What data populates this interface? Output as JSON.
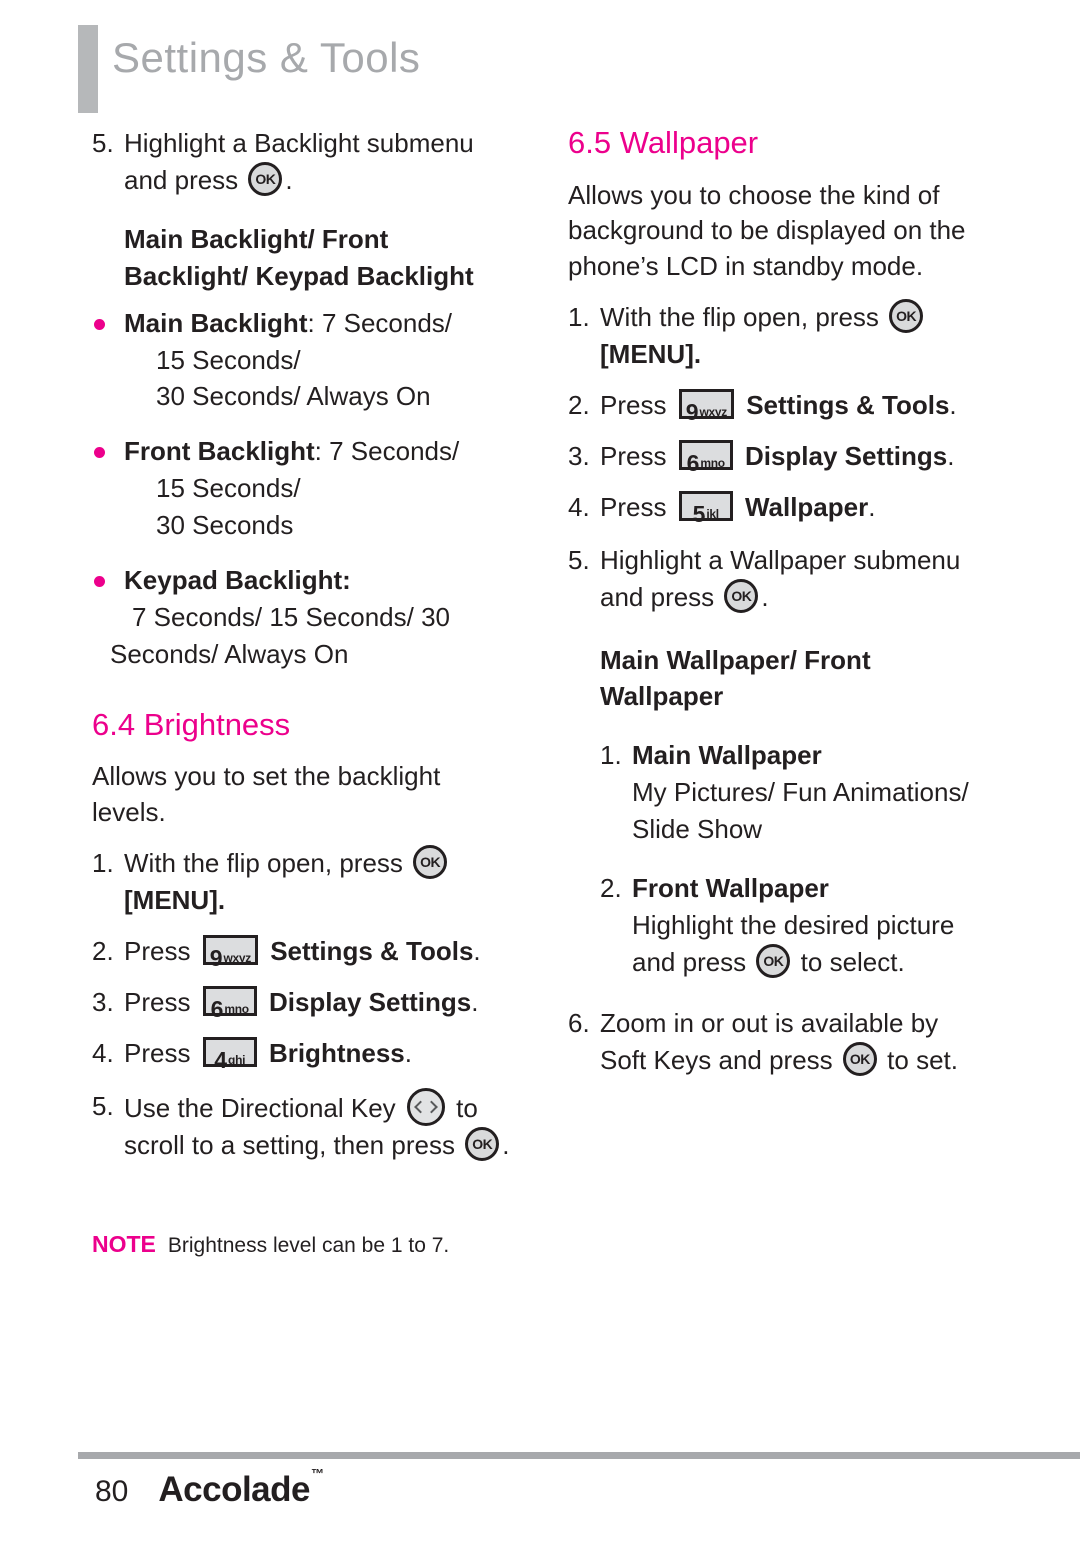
{
  "header": {
    "title": "Settings & Tools"
  },
  "icons": {
    "ok": "ok-key-icon",
    "directional": "directional-key-icon",
    "key9": {
      "digit": "9",
      "letters": "wxyz"
    },
    "key6": {
      "digit": "6",
      "letters": "mno"
    },
    "key5": {
      "digit": "5",
      "letters": "jkl"
    },
    "key4": {
      "digit": "4",
      "letters": "ghi"
    }
  },
  "colors": {
    "accent_pink": "#EC008C",
    "header_gray": "#A7A9AC",
    "bar_gray": "#B6B8BA",
    "text": "#231F20"
  },
  "left_column": {
    "step5": {
      "num": "5.",
      "text_before": "Highlight a Backlight submenu and press",
      "text_after": "."
    },
    "subhead": "Main Backlight/ Front Backlight/ Keypad Backlight",
    "bullets": [
      {
        "label": "Main Backlight",
        "sep": ": ",
        "values": [
          "7 Seconds/",
          "15 Seconds/",
          "30 Seconds/ Always On"
        ]
      },
      {
        "label": "Front Backlight",
        "sep": ": ",
        "values": [
          "7 Seconds/",
          "15 Seconds/",
          "30 Seconds"
        ]
      },
      {
        "label": "Keypad Backlight:",
        "sep": "",
        "values": [
          "7 Seconds/ 15 Seconds/ 30",
          "Seconds/ Always On"
        ]
      }
    ],
    "section": {
      "heading": "6.4 Brightness",
      "intro": "Allows you to set the backlight levels.",
      "steps": [
        {
          "num": "1.",
          "before": "With the flip open, press",
          "after": "",
          "after_bold": "[MENU]."
        },
        {
          "num": "2.",
          "before": "Press",
          "key": "key9",
          "after_bold": "Settings & Tools",
          "after": "."
        },
        {
          "num": "3.",
          "before": "Press",
          "key": "key6",
          "after_bold": "Display Settings",
          "after": "."
        },
        {
          "num": "4.",
          "before": "Press",
          "key": "key4",
          "after_bold": "Brightness",
          "after": "."
        },
        {
          "num": "5.",
          "before": "Use the Directional Key",
          "mid": "to scroll to a setting, then press",
          "after": "."
        }
      ]
    },
    "note": {
      "keyword": "NOTE",
      "text": "Brightness level can be 1 to 7."
    }
  },
  "right_column": {
    "section": {
      "heading": "6.5 Wallpaper",
      "intro": "Allows you to choose the kind of background to be displayed on the phone’s LCD in standby mode.",
      "steps": [
        {
          "num": "1.",
          "before": "With the flip open, press",
          "after_bold": "[MENU]."
        },
        {
          "num": "2.",
          "before": "Press",
          "key": "key9",
          "after_bold": "Settings & Tools",
          "after": "."
        },
        {
          "num": "3.",
          "before": "Press",
          "key": "key6",
          "after_bold": "Display Settings",
          "after": "."
        },
        {
          "num": "4.",
          "before": "Press",
          "key": "key5",
          "after_bold": "Wallpaper",
          "after": "."
        },
        {
          "num": "5.",
          "before": "Highlight a Wallpaper submenu and press",
          "after": "."
        }
      ]
    },
    "subhead": "Main Wallpaper/ Front Wallpaper",
    "sub_steps": [
      {
        "num": "1.",
        "title": "Main Wallpaper",
        "body": "My Pictures/ Fun Animations/ Slide Show"
      },
      {
        "num": "2.",
        "title": "Front Wallpaper",
        "body_before": "Highlight the desired picture and press",
        "body_after": "to select."
      }
    ],
    "step6": {
      "num": "6.",
      "before": "Zoom in or out is available by Soft Keys and press",
      "after": "to set."
    }
  },
  "footer": {
    "page_number": "80",
    "brand": "Accolade",
    "trademark": "™"
  }
}
